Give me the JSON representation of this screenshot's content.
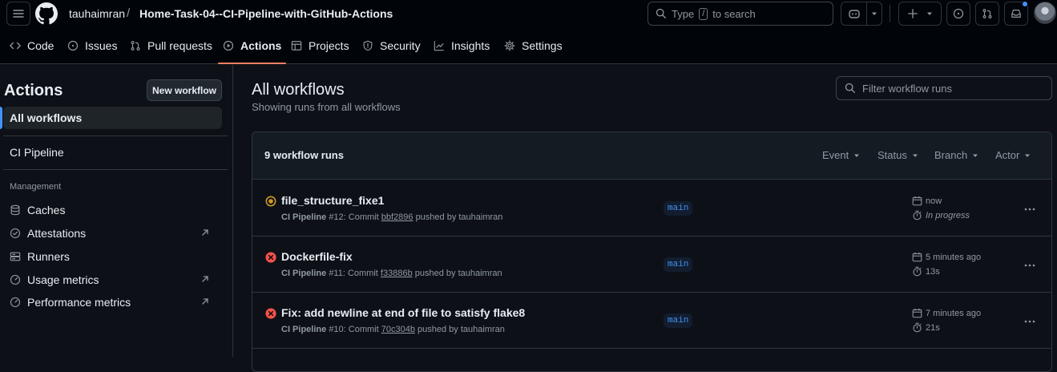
{
  "header": {
    "owner": "tauhaimran",
    "separator": "/",
    "repo": "Home-Task-04--CI-Pipeline-with-GitHub-Actions",
    "search_placeholder_before": "Type",
    "search_key": "/",
    "search_placeholder_after": "to search"
  },
  "tabs": [
    {
      "label": "Code",
      "icon": "code-icon"
    },
    {
      "label": "Issues",
      "icon": "issue-icon"
    },
    {
      "label": "Pull requests",
      "icon": "pull-request-icon"
    },
    {
      "label": "Actions",
      "icon": "play-icon",
      "active": true
    },
    {
      "label": "Projects",
      "icon": "table-icon"
    },
    {
      "label": "Security",
      "icon": "shield-icon"
    },
    {
      "label": "Insights",
      "icon": "graph-icon"
    },
    {
      "label": "Settings",
      "icon": "gear-icon"
    }
  ],
  "sidebar": {
    "title": "Actions",
    "new_workflow": "New workflow",
    "all_workflows": "All workflows",
    "workflows": [
      "CI Pipeline"
    ],
    "management_heading": "Management",
    "management": [
      {
        "label": "Caches",
        "icon": "database-icon"
      },
      {
        "label": "Attestations",
        "icon": "verified-icon",
        "external": true
      },
      {
        "label": "Runners",
        "icon": "server-icon"
      },
      {
        "label": "Usage metrics",
        "icon": "meter-icon",
        "external": true
      },
      {
        "label": "Performance metrics",
        "icon": "meter-icon",
        "external": true
      }
    ]
  },
  "main": {
    "title": "All workflows",
    "subtitle": "Showing runs from all workflows",
    "filter_placeholder": "Filter workflow runs",
    "runs_count": "9 workflow runs",
    "filters": [
      "Event",
      "Status",
      "Branch",
      "Actor"
    ]
  },
  "runs": [
    {
      "title": "file_structure_fixe1",
      "workflow": "CI Pipeline",
      "run_text": "#12: Commit",
      "sha": "bbf2896",
      "pushed_by": "pushed by tauhaimran",
      "branch": "main",
      "time": "now",
      "duration": "In progress",
      "status": "in-progress",
      "status_color": "#d29922"
    },
    {
      "title": "Dockerfile-fix",
      "workflow": "CI Pipeline",
      "run_text": "#11: Commit",
      "sha": "f33886b",
      "pushed_by": "pushed by tauhaimran",
      "branch": "main",
      "time": "5 minutes ago",
      "duration": "13s",
      "status": "failure",
      "status_color": "#f85149"
    },
    {
      "title": "Fix: add newline at end of file to satisfy flake8",
      "workflow": "CI Pipeline",
      "run_text": "#10: Commit",
      "sha": "70c304b",
      "pushed_by": "pushed by tauhaimran",
      "branch": "main",
      "time": "7 minutes ago",
      "duration": "21s",
      "status": "failure",
      "status_color": "#f85149"
    }
  ],
  "colors": {
    "accent_tab": "#f78166",
    "link": "#4493f8",
    "notification_dot": "#4493f8"
  }
}
